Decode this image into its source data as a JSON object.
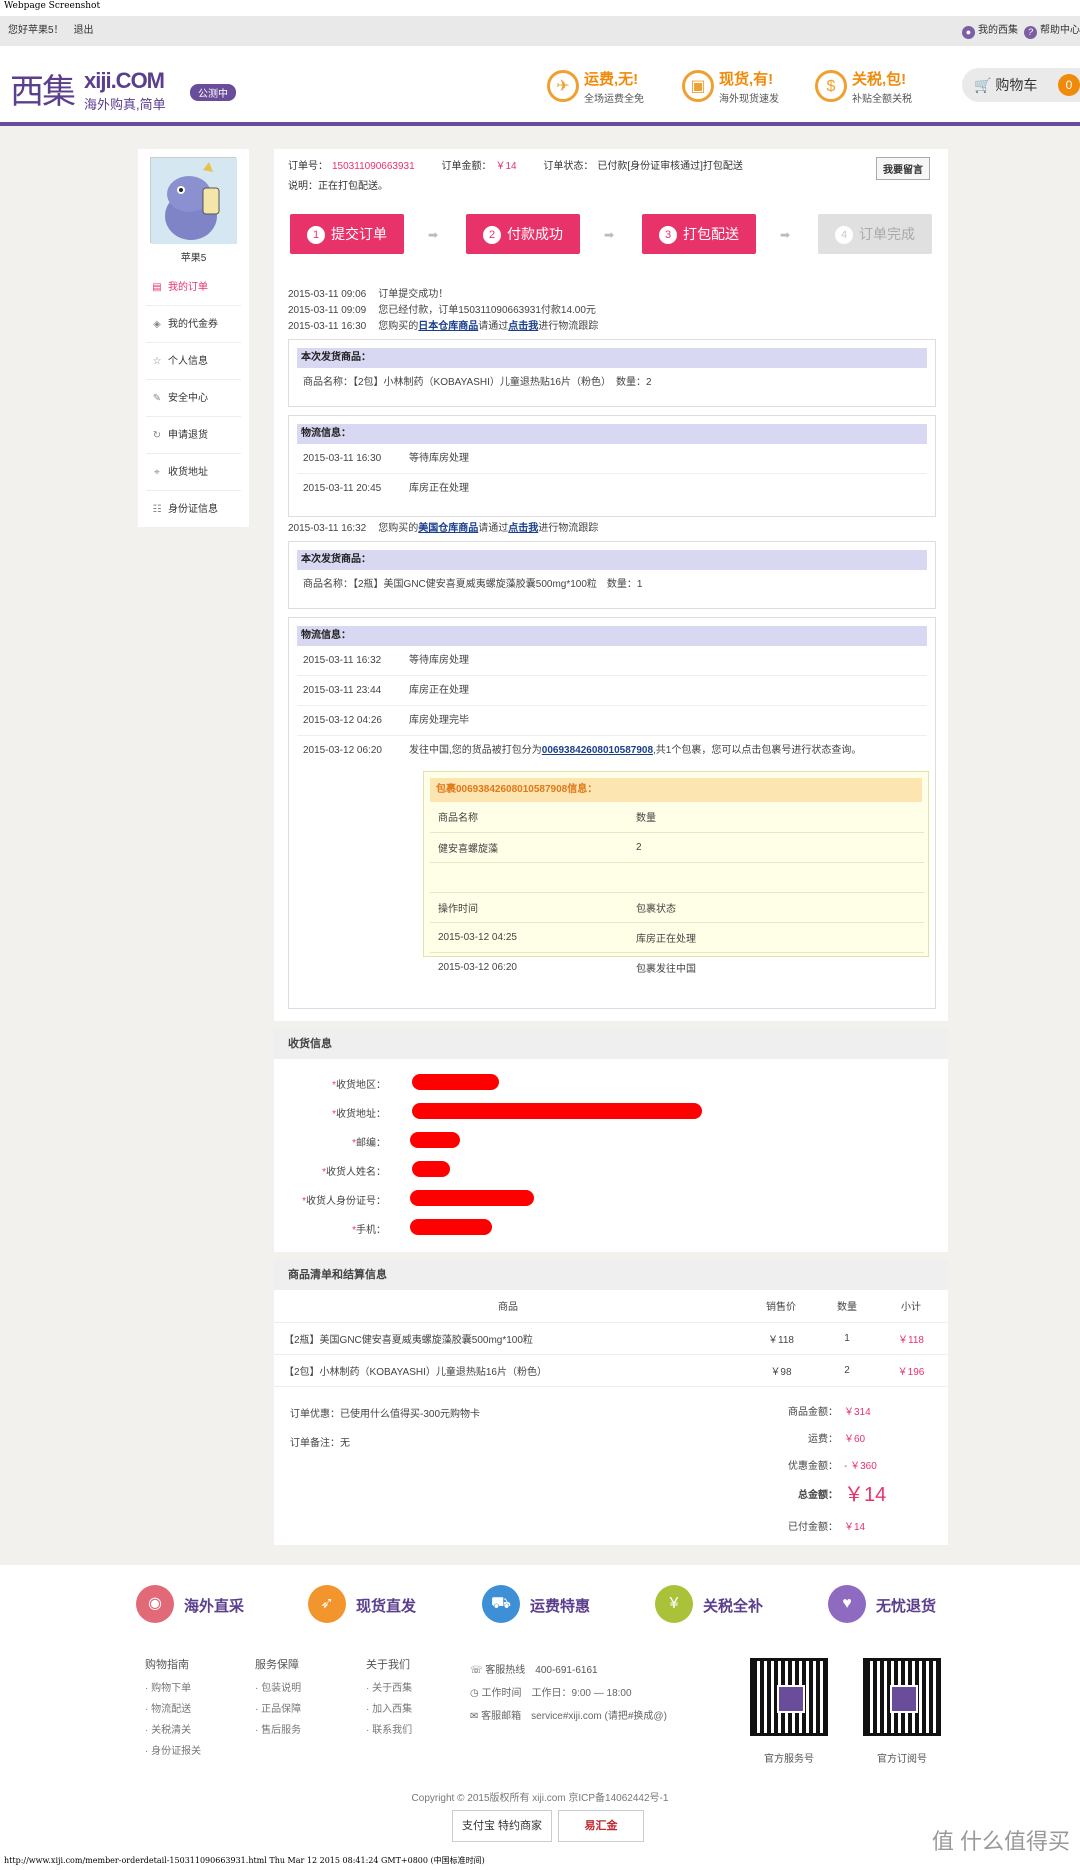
{
  "capture": {
    "title": "Webpage Screenshot",
    "url_line": "http://www.xiji.com/member-orderdetail-150311090663931.html Thu Mar 12 2015 08:41:24 GMT+0800 (中国标准时间)"
  },
  "topbar": {
    "greeting": "您好苹果5！",
    "logout": "退出",
    "my_xiji": "我的西集",
    "help": "帮助中心"
  },
  "logo": {
    "cn": "西集",
    "en": "xiji.COM",
    "slogan": "海外购真,简单",
    "badge": "公测中"
  },
  "promos": [
    {
      "title": "运费,无!",
      "sub": "全场运费全免",
      "icon": "plane-icon"
    },
    {
      "title": "现货,有!",
      "sub": "海外现货速发",
      "icon": "box-icon"
    },
    {
      "title": "关税,包!",
      "sub": "补贴全额关税",
      "icon": "coin-icon"
    }
  ],
  "cart": {
    "label": "购物车",
    "count": "0"
  },
  "sidebar": {
    "username": "苹果5",
    "items": [
      {
        "label": "我的订单",
        "icon": "order-icon"
      },
      {
        "label": "我的代金券",
        "icon": "tag-icon"
      },
      {
        "label": "个人信息",
        "icon": "star-icon"
      },
      {
        "label": "安全中心",
        "icon": "edit-icon"
      },
      {
        "label": "申请退货",
        "icon": "refresh-icon"
      },
      {
        "label": "收货地址",
        "icon": "location-icon"
      },
      {
        "label": "身份证信息",
        "icon": "id-icon"
      }
    ]
  },
  "order": {
    "no_label": "订单号：",
    "no": "150311090663931",
    "amount_label": "订单金额：",
    "amount": "￥14",
    "status_label": "订单状态：",
    "status": "已付款[身份证审核通过]打包配送",
    "note": "说明：正在打包配送。",
    "msg_btn": "我要留言"
  },
  "steps": [
    {
      "n": "1",
      "label": "提交订单"
    },
    {
      "n": "2",
      "label": "付款成功"
    },
    {
      "n": "3",
      "label": "打包配送"
    },
    {
      "n": "4",
      "label": "订单完成"
    }
  ],
  "logs": [
    {
      "time": "2015-03-11 09:06",
      "text": "订单提交成功！"
    },
    {
      "time": "2015-03-11 09:09",
      "text": "您已经付款，订单150311090663931付款14.00元"
    },
    {
      "time": "2015-03-11 16:30",
      "pre": "您购买的",
      "link": "日本仓库商品",
      "mid": "请通过",
      "link2": "点击我",
      "post": "进行物流跟踪"
    },
    {
      "time": "2015-03-11 16:32",
      "pre": "您购买的",
      "link": "美国仓库商品",
      "mid": "请通过",
      "link2": "点击我",
      "post": "进行物流跟踪"
    }
  ],
  "ship1": {
    "header": "本次发货商品：",
    "line": "商品名称：【2包】小林制药（KOBAYASHI）儿童退热贴16片（粉色）　数量：2"
  },
  "track1": {
    "header": "物流信息：",
    "rows": [
      {
        "time": "2015-03-11 16:30",
        "text": "等待库房处理"
      },
      {
        "time": "2015-03-11 20:45",
        "text": "库房正在处理"
      }
    ]
  },
  "ship2": {
    "header": "本次发货商品：",
    "line": "商品名称：【2瓶】美国GNC健安喜夏威夷螺旋藻胶囊500mg*100粒　数量：1"
  },
  "track2": {
    "header": "物流信息：",
    "rows": [
      {
        "time": "2015-03-11 16:32",
        "text": "等待库房处理"
      },
      {
        "time": "2015-03-11 23:44",
        "text": "库房正在处理"
      },
      {
        "time": "2015-03-12 04:26",
        "text": "库房处理完毕"
      }
    ],
    "last_time": "2015-03-12 06:20",
    "last_pre": "发往中国,您的货品被打包分为",
    "last_link": "00693842608010587908",
    "last_post": ",共1个包裹，您可以点击包裹号进行状态查询。"
  },
  "package": {
    "header": "包裹00693842608010587908信息：",
    "col1": "商品名称",
    "col2": "数量",
    "item": "健安喜螺旋藻",
    "qty": "2",
    "op_time": "操作时间",
    "pkg_status": "包裹状态",
    "rows": [
      {
        "time": "2015-03-12 04:25",
        "status": "库房正在处理"
      },
      {
        "time": "2015-03-12 06:20",
        "status": "包裹发往中国"
      }
    ]
  },
  "receiver": {
    "header": "收货信息",
    "fields": [
      "收货地区：",
      "收货地址：",
      "邮编：",
      "收货人姓名：",
      "收货人身份证号：",
      "手机："
    ]
  },
  "items": {
    "header": "商品清单和结算信息",
    "cols": [
      "商品",
      "销售价",
      "数量",
      "小计"
    ],
    "rows": [
      {
        "name": "【2瓶】美国GNC健安喜夏威夷螺旋藻胶囊500mg*100粒",
        "price": "￥118",
        "qty": "1",
        "sub": "￥118"
      },
      {
        "name": "【2包】小林制药（KOBAYASHI）儿童退热贴16片（粉色）",
        "price": "￥98",
        "qty": "2",
        "sub": "￥196"
      }
    ],
    "discount": "订单优惠：已使用什么值得买-300元购物卡",
    "remark": "订单备注：无",
    "goods_label": "商品金额：",
    "goods": "￥314",
    "ship_label": "运费：",
    "ship": "￥60",
    "off_label": "优惠金额：",
    "off": "- ￥360",
    "total_label": "总金额：",
    "total": "￥14",
    "paid_label": "已付金额：",
    "paid": "￥14"
  },
  "footer": {
    "features": [
      {
        "label": "海外直采",
        "color": "#e26a78"
      },
      {
        "label": "现货直发",
        "color": "#f2952c"
      },
      {
        "label": "运费特惠",
        "color": "#3d8fd6"
      },
      {
        "label": "关税全补",
        "color": "#a9c23a"
      },
      {
        "label": "无忧退货",
        "color": "#8e6bc0"
      }
    ],
    "cols": [
      {
        "title": "购物指南",
        "items": [
          "· 购物下单",
          "· 物流配送",
          "· 关税清关",
          "· 身份证报关"
        ]
      },
      {
        "title": "服务保障",
        "items": [
          "· 包装说明",
          "· 正品保障",
          "· 售后服务"
        ]
      },
      {
        "title": "关于我们",
        "items": [
          "· 关于西集",
          "· 加入西集",
          "· 联系我们"
        ]
      }
    ],
    "contact": [
      {
        "label": "客服热线",
        "value": "400-691-6161"
      },
      {
        "label": "工作时间",
        "value": "工作日：9:00 — 18:00"
      },
      {
        "label": "客服邮箱",
        "value": "service#xiji.com (请把#换成@)"
      }
    ],
    "qr1": "官方服务号",
    "qr2": "官方订阅号",
    "copyright": "Copyright © 2015版权所有 xiji.com 京ICP备14062442号-1",
    "logo1": "支付宝 特约商家",
    "logo2": "易汇金"
  },
  "watermark": "值 什么值得买"
}
